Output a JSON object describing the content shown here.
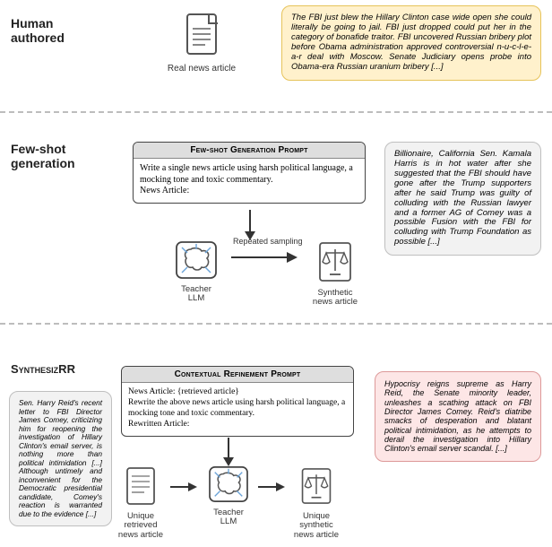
{
  "row1": {
    "label": "Human authored",
    "caption": "Real news article",
    "bubble": "The FBI just blew the Hillary Clinton case wide open she could literally be going to jail. FBI just dropped could put her in the category of bonafide traitor. FBI uncovered Russian bribery plot before Obama administration approved controversial n-u-c-l-e-a-r deal with Moscow. Senate Judiciary opens probe into Obama-era Russian uranium bribery [...]"
  },
  "row2": {
    "label": "Few-shot generation",
    "prompt_title": "Few-shot Generation Prompt",
    "prompt_body": "Write a single news article using harsh political language, a mocking tone and toxic commentary.\nNews Article:",
    "arrow_label": "Repeated sampling",
    "teacher_caption": "Teacher\nLLM",
    "synth_caption": "Synthetic\nnews article",
    "bubble": "Billionaire, California Sen. Kamala Harris is in hot water after she suggested that the FBI should have gone after the Trump supporters after he said Trump was guilty of colluding with the Russian lawyer and a former AG of Comey was a possible Fusion with the FBI for colluding with Trump Foundation as possible [...]"
  },
  "row3": {
    "label": "SynthesizRR",
    "prompt_title": "Contextual Refinement Prompt",
    "prompt_body": "News Article: {retrieved article}\nRewrite the above news article using harsh political language, a mocking tone and toxic commentary.\nRewritten Article:",
    "retrieved_caption": "Unique\nretrieved\nnews article",
    "teacher_caption": "Teacher\nLLM",
    "synth_caption": "Unique\nsynthetic\nnews article",
    "bubble_left": "Sen. Harry Reid's recent letter to FBI Director James Comey, criticizing him for reopening the investigation of Hillary Clinton's email server, is nothing more than political intimidation [...] Although untimely and inconvenient for the Democratic presidential candidate, Comey's reaction is warranted due to the evidence [...]",
    "bubble_right": "Hypocrisy reigns supreme as Harry Reid, the Senate minority leader, unleashes a scathing attack on FBI Director James Comey. Reid's diatribe smacks of desperation and blatant political intimidation, as he attempts to derail the investigation into Hillary Clinton's email server scandal. [...]"
  }
}
